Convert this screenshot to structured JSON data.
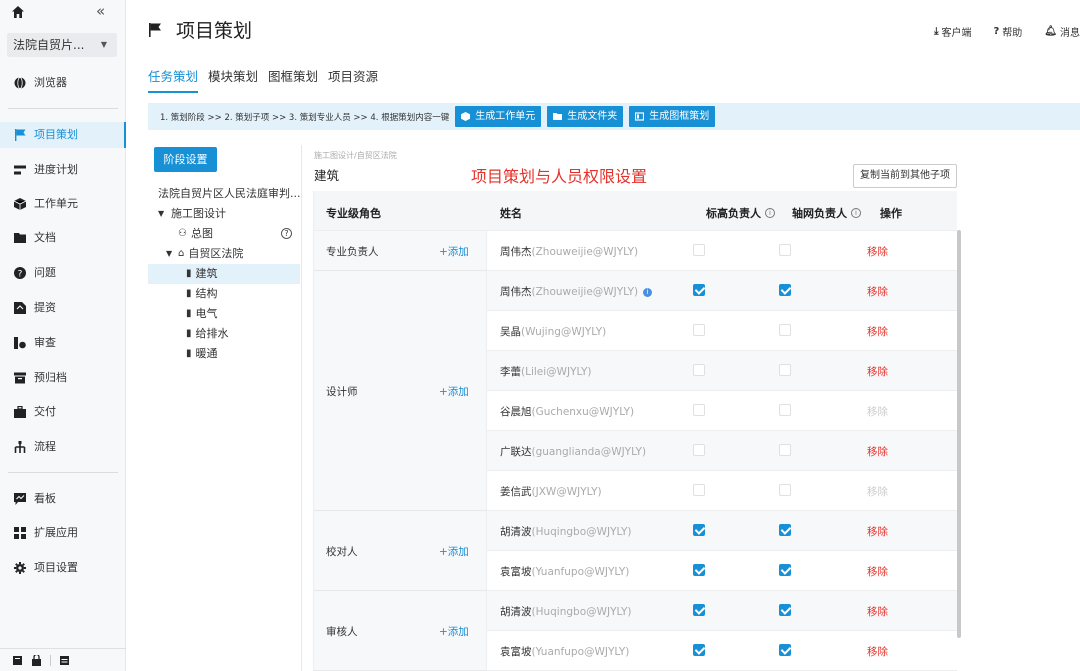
{
  "sidebar": {
    "project_select": "法院自贸片...",
    "items": [
      {
        "label": "浏览器",
        "icon": "globe-icon"
      },
      {
        "label": "项目策划",
        "icon": "flag-icon",
        "active": true
      },
      {
        "label": "进度计划",
        "icon": "progress-icon"
      },
      {
        "label": "工作单元",
        "icon": "cube-icon"
      },
      {
        "label": "文档",
        "icon": "folder-icon"
      },
      {
        "label": "问题",
        "icon": "question-icon"
      },
      {
        "label": "提资",
        "icon": "submit-icon"
      },
      {
        "label": "审查",
        "icon": "review-icon"
      },
      {
        "label": "预归档",
        "icon": "archive-icon"
      },
      {
        "label": "交付",
        "icon": "briefcase-icon"
      },
      {
        "label": "流程",
        "icon": "flow-icon"
      },
      {
        "label": "看板",
        "icon": "dashboard-icon"
      },
      {
        "label": "扩展应用",
        "icon": "apps-icon"
      },
      {
        "label": "项目设置",
        "icon": "gear-icon"
      }
    ]
  },
  "header": {
    "title": "项目策划",
    "client_label": "客户端",
    "help_label": "帮助",
    "messages_label": "消息"
  },
  "tabs": [
    {
      "label": "任务策划",
      "active": true
    },
    {
      "label": "模块策划"
    },
    {
      "label": "图框策划"
    },
    {
      "label": "项目资源"
    }
  ],
  "steps": {
    "text": "1. 策划阶段 >> 2. 策划子项 >> 3. 策划专业人员 >> 4. 根据策划内容一键",
    "btn_work_unit": "生成工作单元",
    "btn_folder": "生成文件夹",
    "btn_frame": "生成图框策划"
  },
  "stage_button": "阶段设置",
  "tree": {
    "root": "法院自贸片区人民法庭审判...",
    "phase": "施工图设计",
    "general": "总图",
    "building": "自贸区法院",
    "disciplines": [
      "建筑",
      "结构",
      "电气",
      "给排水",
      "暖通"
    ],
    "selected": "建筑"
  },
  "content": {
    "breadcrumb": "施工图设计/自贸区法院",
    "section_title": "建筑",
    "red_title": "项目策划与人员权限设置",
    "copy_button": "复制当前到其他子项"
  },
  "table": {
    "headers": {
      "role": "专业级角色",
      "name": "姓名",
      "elevation": "标高负责人",
      "axis": "轴网负责人",
      "ops": "操作"
    },
    "add_label": "+添加",
    "remove_label": "移除",
    "roles": [
      {
        "role": "专业负责人",
        "rows": [
          {
            "name": "周伟杰",
            "account": "(Zhouweijie@WJYLY)",
            "elev": false,
            "axis": false,
            "removable": true
          }
        ]
      },
      {
        "role": "设计师",
        "rows": [
          {
            "name": "周伟杰",
            "account": "(Zhouweijie@WJYLY)",
            "elev": true,
            "axis": true,
            "removable": true,
            "badge": true
          },
          {
            "name": "吴晶",
            "account": "(Wujing@WJYLY)",
            "elev": false,
            "axis": false,
            "removable": true
          },
          {
            "name": "李蕾",
            "account": "(Lilei@WJYLY)",
            "elev": false,
            "axis": false,
            "removable": true
          },
          {
            "name": "谷晨旭",
            "account": "(Guchenxu@WJYLY)",
            "elev": false,
            "axis": false,
            "removable": false
          },
          {
            "name": "广联达",
            "account": "(guanglianda@WJYLY)",
            "elev": false,
            "axis": false,
            "removable": true
          },
          {
            "name": "姜信武",
            "account": "(JXW@WJYLY)",
            "elev": false,
            "axis": false,
            "removable": false
          }
        ]
      },
      {
        "role": "校对人",
        "rows": [
          {
            "name": "胡清波",
            "account": "(Huqingbo@WJYLY)",
            "elev": true,
            "axis": true,
            "removable": true
          },
          {
            "name": "袁富坡",
            "account": "(Yuanfupo@WJYLY)",
            "elev": true,
            "axis": true,
            "removable": true
          }
        ]
      },
      {
        "role": "审核人",
        "rows": [
          {
            "name": "胡清波",
            "account": "(Huqingbo@WJYLY)",
            "elev": true,
            "axis": true,
            "removable": true
          },
          {
            "name": "袁富坡",
            "account": "(Yuanfupo@WJYLY)",
            "elev": true,
            "axis": true,
            "removable": true
          }
        ]
      }
    ]
  },
  "colors": {
    "accent": "#1890d5",
    "danger": "#e4322b",
    "highlight_bg": "#e3f1fb"
  }
}
